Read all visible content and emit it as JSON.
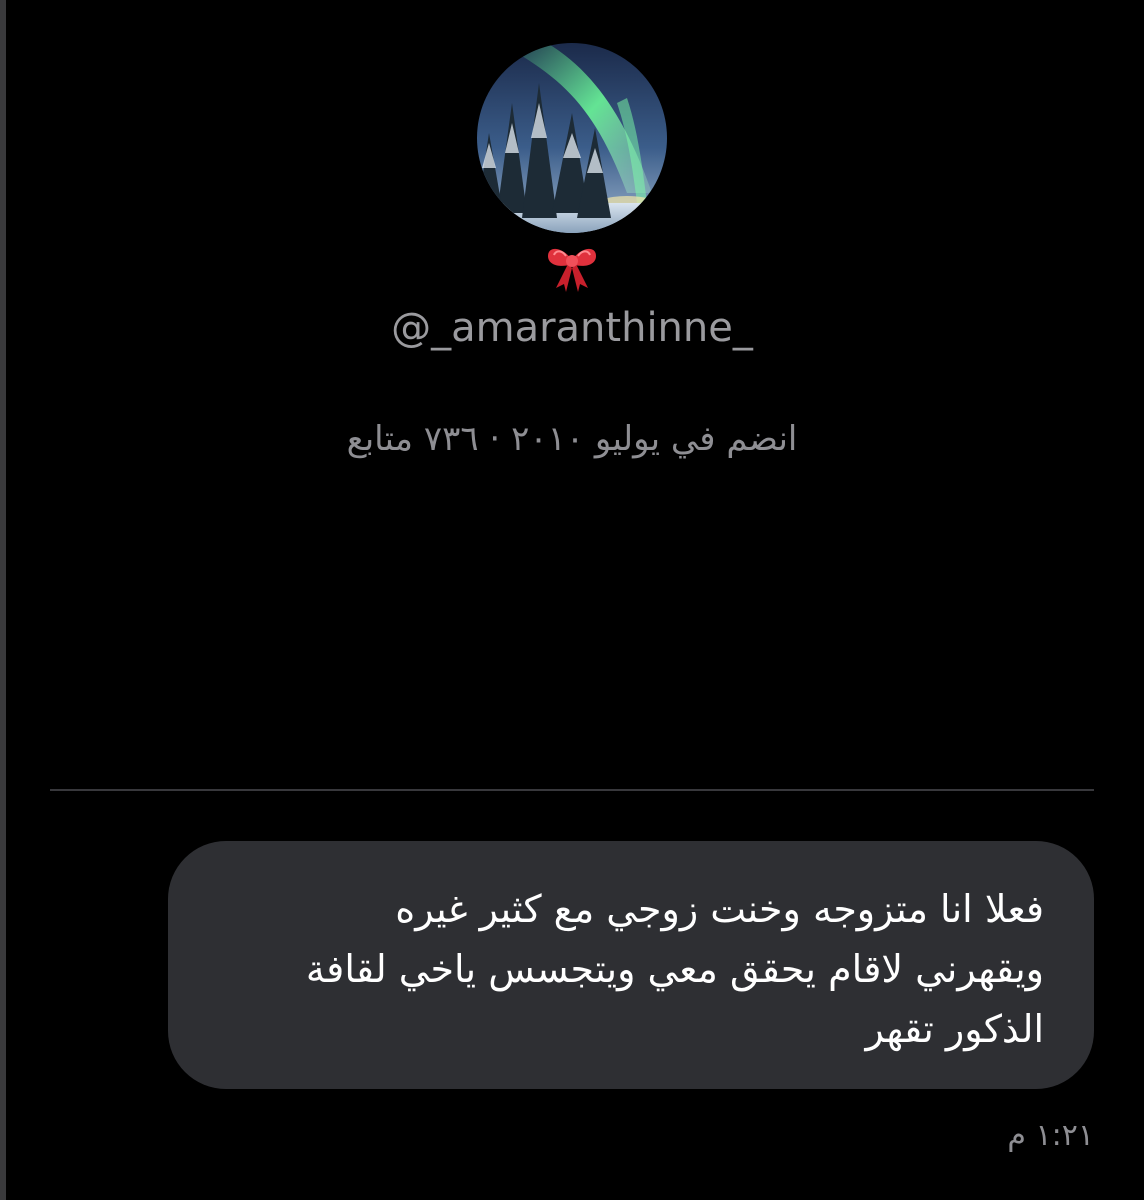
{
  "profile": {
    "handle": "@_amaranthinne_",
    "joined": "انضم في يوليو ٢٠١٠ · ٧٣٦ متابع",
    "avatar_icon": "aurora-forest-avatar",
    "badge_icon": "red-bow-icon"
  },
  "message": {
    "text": "فعلا انا متزوجه وخنت زوجي مع كثير غيره\nويقهرني لاقام يحقق معي ويتجسس ياخي لقافة\nالذكور تقهر",
    "time": "١:٢١ م"
  },
  "colors": {
    "background": "#000000",
    "bubble": "#2e2f33",
    "muted_text": "#8e8e93",
    "bow": "#e0313d"
  }
}
